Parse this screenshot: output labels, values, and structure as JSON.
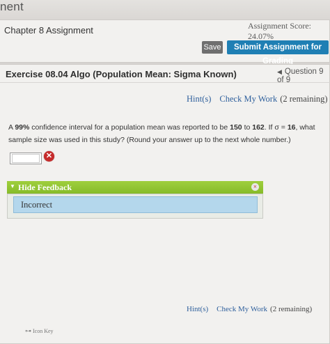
{
  "header": {
    "title_fragment": "nent"
  },
  "assignment": {
    "title": "Chapter 8 Assignment",
    "score": "Assignment Score: 24.07%",
    "save_label": "Save",
    "submit_label": "Submit Assignment for Grading"
  },
  "exercise": {
    "title": "Exercise 08.04 Algo (Population Mean: Sigma Known)",
    "question_nav": "Question 9 of 9",
    "hints_label": "Hint(s)",
    "check_label": "Check My Work",
    "check_remaining": "(2 remaining)"
  },
  "question": {
    "p1": "A ",
    "pct": "99%",
    "p2": " confidence interval for a population mean was reported to be ",
    "low": "150",
    "p3": " to ",
    "high": "162",
    "p4": ". If σ = ",
    "sigma": "16",
    "p5": ", what sample size was used in this study? (Round your answer up to the next whole number.)",
    "answer_value": ""
  },
  "feedback": {
    "toggle_label": "Hide Feedback",
    "message": "Incorrect"
  },
  "footer": {
    "hints_label": "Hint(s)",
    "check_label": "Check My Work",
    "check_remaining": "(2 remaining)",
    "icon_key_label": "Icon Key"
  },
  "colors": {
    "accent": "#1f7fb4",
    "feedback_green": "#8fc230",
    "incorrect_blue": "#b4d7ec",
    "error_red": "#c62b2b"
  }
}
